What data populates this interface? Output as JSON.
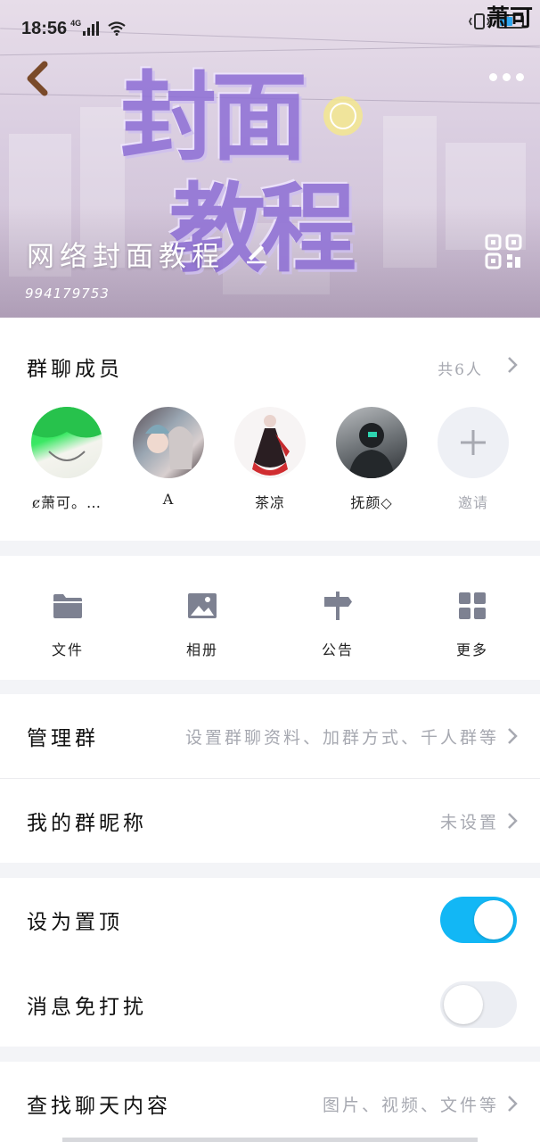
{
  "status_bar": {
    "time": "18:56",
    "network": "4G",
    "signature": "萧可"
  },
  "cover": {
    "art_line1": "封面",
    "art_line2": "教程",
    "group_name": "网络封面教程",
    "group_id": "994179753"
  },
  "members": {
    "title": "群聊成员",
    "count": "共6人",
    "list": [
      {
        "name": "ȼ萧可。…"
      },
      {
        "name": "A"
      },
      {
        "name": "茶凉"
      },
      {
        "name": "抚颜◇"
      },
      {
        "name": "邀请"
      }
    ]
  },
  "tools": [
    {
      "label": "文件",
      "icon": "folder-icon"
    },
    {
      "label": "相册",
      "icon": "image-icon"
    },
    {
      "label": "公告",
      "icon": "signpost-icon"
    },
    {
      "label": "更多",
      "icon": "grid-icon"
    }
  ],
  "manage": {
    "title": "管理群",
    "meta": "设置群聊资料、加群方式、千人群等"
  },
  "nickname": {
    "title": "我的群昵称",
    "meta": "未设置"
  },
  "pin": {
    "title": "设为置顶",
    "on": true
  },
  "mute": {
    "title": "消息免打扰",
    "on": false
  },
  "search": {
    "title": "查找聊天内容",
    "meta": "图片、视频、文件等"
  },
  "colors": {
    "accent": "#12b7f5",
    "muted_text": "#a7a9b1"
  }
}
